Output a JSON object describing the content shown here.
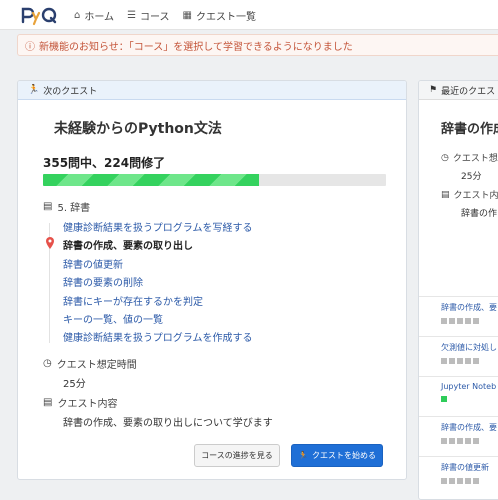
{
  "nav": {
    "logo": "PyQ",
    "home": "ホーム",
    "course": "コース",
    "quest_list": "クエスト一覧"
  },
  "notice": {
    "text": "新機能のお知らせ：「コース」を選択して学習できるようになりました"
  },
  "next_quest": {
    "header": "次のクエスト",
    "title": "未経験からのPython文法",
    "progress_text": "355問中、224問修了",
    "progress_ratio": 0.631,
    "chapter": "5. 辞書",
    "lessons": [
      {
        "label": "健康診断結果を扱うプログラムを写経する",
        "current": false
      },
      {
        "label": "辞書の作成、要素の取り出し",
        "current": true
      },
      {
        "label": "辞書の値更新",
        "current": false
      },
      {
        "label": "辞書の要素の削除",
        "current": false
      },
      {
        "label": "辞書にキーが存在するかを判定",
        "current": false
      },
      {
        "label": "キーの一覧、値の一覧",
        "current": false
      },
      {
        "label": "健康診断結果を扱うプログラムを作成する",
        "current": false
      }
    ],
    "time_label": "クエスト想定時間",
    "time_value": "25分",
    "content_label": "クエスト内容",
    "content_value": "辞書の作成、要素の取り出しについて学びます",
    "btn_progress": "コースの進捗を見る",
    "btn_start": "クエストを始める"
  },
  "recent_quest": {
    "header": "最近のクエスト",
    "title": "辞書の作成",
    "time_label": "クエスト想",
    "time_value": "25分",
    "content_label": "クエスト内",
    "content_value": "辞書の作",
    "items": [
      {
        "title": "辞書の作成、要",
        "done": 0,
        "total": 5
      },
      {
        "title": "欠測値に対処し",
        "done": 0,
        "total": 5
      },
      {
        "title": "Jupyter Noteb",
        "done": 1,
        "total": 1
      },
      {
        "title": "辞書の作成、要",
        "done": 0,
        "total": 5
      },
      {
        "title": "辞書の値更新",
        "done": 0,
        "total": 5
      }
    ]
  },
  "colors": {
    "accent": "#1f6fd6",
    "link": "#2c5aa8",
    "progress": "#34d25e",
    "notice": "#c4553a"
  }
}
